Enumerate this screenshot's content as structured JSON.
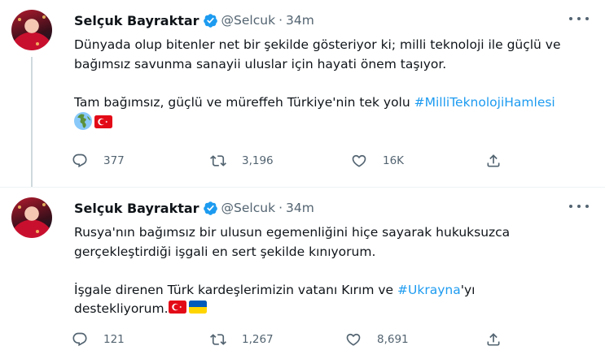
{
  "tweets": [
    {
      "author": {
        "name": "Selçuk Bayraktar",
        "handle": "@Selcuk"
      },
      "separator": "·",
      "time": "34m",
      "lines": [
        "Dünyada olup bitenler net bir şekilde gösteriyor ki; milli teknoloji ile güçlü ve",
        "bağımsız savunma sanayii uluslar için hayati önem taşıyor."
      ],
      "line3_text": "Tam bağımsız, güçlü ve müreffeh Türkiye'nin tek yolu ",
      "hashtag": "#MilliTeknolojiHamlesi",
      "emojis": [
        "globe-europe-africa",
        "flag-turkey"
      ],
      "counts": {
        "replies": "377",
        "retweets": "3,196",
        "likes": "16K"
      }
    },
    {
      "author": {
        "name": "Selçuk Bayraktar",
        "handle": "@Selcuk"
      },
      "separator": "·",
      "time": "34m",
      "lines": [
        "Rusya'nın bağımsız bir ulusun egemenliğini hiçe sayarak hukuksuzca",
        "gerçekleştirdiği işgali en sert şekilde kınıyorum."
      ],
      "line3_text": "İşgale direnen Türk kardeşlerimizin vatanı Kırım ve ",
      "hashtag": "#Ukrayna",
      "line3_suffix": "'yı",
      "line4_text": "destekliyorum.",
      "emojis": [
        "flag-turkey",
        "flag-ukraine"
      ],
      "counts": {
        "replies": "121",
        "retweets": "1,267",
        "likes": "8,691"
      }
    }
  ],
  "colors": {
    "accent": "#1d9bf0",
    "text": "#0f1419",
    "muted": "#536471",
    "divider": "#eff3f4",
    "thread": "#cfd9de"
  }
}
